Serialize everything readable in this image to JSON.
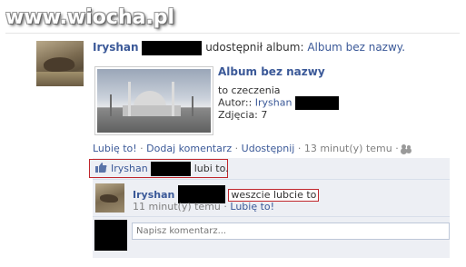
{
  "watermark": "www.wiocha.pl",
  "post": {
    "author": "Iryshan",
    "action": "udostępnił album:",
    "album_link": "Album bez nazwy."
  },
  "album": {
    "title": "Album bez nazwy",
    "created": "to czeczenia",
    "author_label": "Autor:: ",
    "author_name": "Iryshan",
    "photos_label": "Zdjęcia: ",
    "photos_count": "7"
  },
  "actions": {
    "like": "Lubię to!",
    "sep": " · ",
    "comment": "Dodaj komentarz",
    "share": "Udostępnij",
    "time": "13 minut(y) temu",
    "tail": " · "
  },
  "likes": {
    "name": "Iryshan",
    "suffix": "lubi to."
  },
  "comment": {
    "author": "Iryshan",
    "text": "weszcie lubcie to",
    "time": "11 minut(y) temu",
    "sep": " · ",
    "like": "Lubię to!"
  },
  "composer": {
    "placeholder": "Napisz komentarz..."
  },
  "colors": {
    "link": "#3b5998",
    "highlight_border": "#c0272d",
    "ufi_bg": "#edeff4"
  }
}
